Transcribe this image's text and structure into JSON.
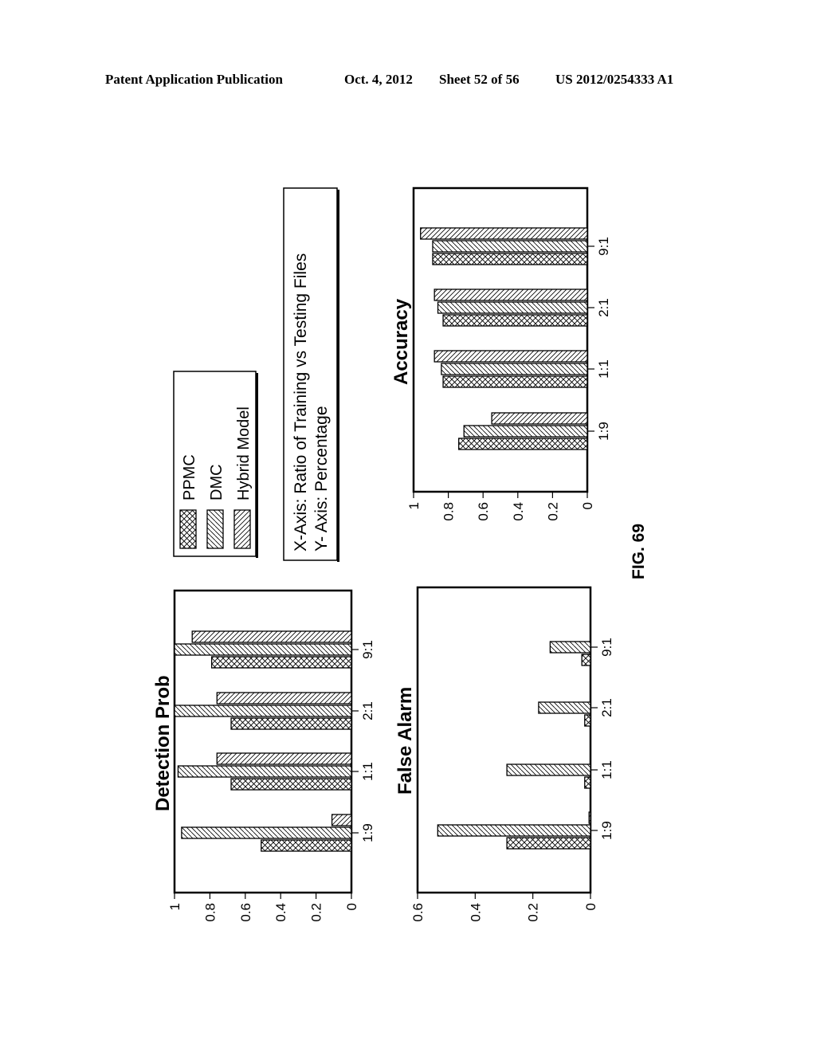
{
  "header": {
    "publication": "Patent Application Publication",
    "date": "Oct. 4, 2012",
    "sheet": "Sheet 52 of 56",
    "number": "US 2012/0254333 A1"
  },
  "figure_label": "FIG. 69",
  "legend": {
    "items": [
      {
        "name": "PPMC",
        "pattern": "cross-hatch"
      },
      {
        "name": "DMC",
        "pattern": "back-diagonal"
      },
      {
        "name": "Hybrid Model",
        "pattern": "forward-diagonal"
      }
    ]
  },
  "axis_note": {
    "line1": "X-Axis: Ratio of Training vs Testing Files",
    "line2": "Y- Axis: Percentage"
  },
  "chart_data": [
    {
      "type": "bar",
      "title": "Detection Prob",
      "categories": [
        "1:9",
        "1:1",
        "2:1",
        "9:1"
      ],
      "series": [
        {
          "name": "PPMC",
          "values": [
            0.51,
            0.68,
            0.68,
            0.79
          ]
        },
        {
          "name": "DMC",
          "values": [
            0.96,
            0.98,
            1.0,
            1.0
          ]
        },
        {
          "name": "Hybrid Model",
          "values": [
            0.11,
            0.76,
            0.76,
            0.9
          ]
        }
      ],
      "xlabel": "Ratio of Training vs Testing Files",
      "ylabel": "Percentage",
      "ylim": [
        0,
        1
      ],
      "yticks": [
        "0",
        "0.2",
        "0.4",
        "0.6",
        "0.8",
        "1"
      ],
      "grid": false,
      "orientation": "rotated-90"
    },
    {
      "type": "bar",
      "title": "False Alarm",
      "categories": [
        "1:9",
        "1:1",
        "2:1",
        "9:1"
      ],
      "series": [
        {
          "name": "PPMC",
          "values": [
            0.29,
            0.02,
            0.02,
            0.03
          ]
        },
        {
          "name": "DMC",
          "values": [
            0.53,
            0.29,
            0.18,
            0.14
          ]
        },
        {
          "name": "Hybrid Model",
          "values": [
            0.005,
            0,
            0,
            0
          ]
        }
      ],
      "xlabel": "Ratio of Training vs Testing Files",
      "ylabel": "Percentage",
      "ylim": [
        0,
        0.6
      ],
      "yticks": [
        "0",
        "0.2",
        "0.4",
        "0.6"
      ],
      "grid": false,
      "orientation": "rotated-90"
    },
    {
      "type": "bar",
      "title": "Accuracy",
      "categories": [
        "1:9",
        "1:1",
        "2:1",
        "9:1"
      ],
      "series": [
        {
          "name": "PPMC",
          "values": [
            0.74,
            0.83,
            0.83,
            0.89
          ]
        },
        {
          "name": "DMC",
          "values": [
            0.71,
            0.84,
            0.86,
            0.89
          ]
        },
        {
          "name": "Hybrid Model",
          "values": [
            0.55,
            0.88,
            0.88,
            0.96
          ]
        }
      ],
      "xlabel": "Ratio of Training vs Testing Files",
      "ylabel": "Percentage",
      "ylim": [
        0,
        1
      ],
      "yticks": [
        "0",
        "0.2",
        "0.4",
        "0.6",
        "0.8",
        "1"
      ],
      "grid": false,
      "orientation": "rotated-90"
    }
  ]
}
